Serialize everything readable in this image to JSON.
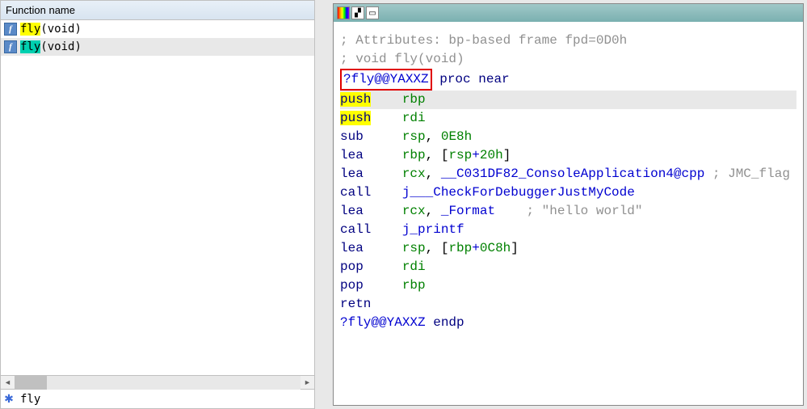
{
  "left": {
    "header": "Function name",
    "functions": [
      {
        "highlight_class": "hl-yellow",
        "name": "fly",
        "rest": "(void)"
      },
      {
        "highlight_class": "hl-teal",
        "name": "fly",
        "rest": "(void)"
      }
    ],
    "search_value": "fly"
  },
  "toolbar": {
    "icon1": "rainbow",
    "icon2": "graph",
    "icon3": "window"
  },
  "disasm": {
    "attr_comment": "; Attributes: bp-based frame fpd=0D0h",
    "decl_comment": "; void fly(void)",
    "mangled": "?fly@@YAXXZ",
    "proc_near": " proc near",
    "lines": [
      {
        "mn": "push",
        "mn_hl": true,
        "args": [
          {
            "t": "rbp",
            "c": "green"
          }
        ],
        "row_hl": true
      },
      {
        "mn": "push",
        "mn_hl": true,
        "args": [
          {
            "t": "rdi",
            "c": "green"
          }
        ]
      },
      {
        "mn": "sub",
        "args": [
          {
            "t": "rsp",
            "c": "green"
          },
          {
            "t": ", ",
            "c": "black"
          },
          {
            "t": "0E8h",
            "c": "green"
          }
        ]
      },
      {
        "mn": "lea",
        "args": [
          {
            "t": "rbp",
            "c": "green"
          },
          {
            "t": ", [",
            "c": "black"
          },
          {
            "t": "rsp",
            "c": "green"
          },
          {
            "t": "+",
            "c": "blue"
          },
          {
            "t": "20h",
            "c": "green"
          },
          {
            "t": "]",
            "c": "black"
          }
        ]
      },
      {
        "mn": "lea",
        "args": [
          {
            "t": "rcx",
            "c": "green"
          },
          {
            "t": ", ",
            "c": "black"
          },
          {
            "t": "__C031DF82_ConsoleApplication4@cpp",
            "c": "blue"
          },
          {
            "t": " ; JMC_flag",
            "c": "comment"
          }
        ]
      },
      {
        "mn": "call",
        "args": [
          {
            "t": "j___CheckForDebuggerJustMyCode",
            "c": "blue"
          }
        ]
      },
      {
        "mn": "lea",
        "args": [
          {
            "t": "rcx",
            "c": "green"
          },
          {
            "t": ", ",
            "c": "black"
          },
          {
            "t": "_Format",
            "c": "blue"
          },
          {
            "t": "    ; \"hello world\"",
            "c": "comment"
          }
        ]
      },
      {
        "mn": "call",
        "args": [
          {
            "t": "j_printf",
            "c": "blue"
          }
        ]
      },
      {
        "mn": "lea",
        "args": [
          {
            "t": "rsp",
            "c": "green"
          },
          {
            "t": ", [",
            "c": "black"
          },
          {
            "t": "rbp",
            "c": "green"
          },
          {
            "t": "+",
            "c": "blue"
          },
          {
            "t": "0C8h",
            "c": "green"
          },
          {
            "t": "]",
            "c": "black"
          }
        ]
      },
      {
        "mn": "pop",
        "args": [
          {
            "t": "rdi",
            "c": "green"
          }
        ]
      },
      {
        "mn": "pop",
        "args": [
          {
            "t": "rbp",
            "c": "green"
          }
        ]
      },
      {
        "mn": "retn",
        "args": []
      }
    ],
    "endp_label": "?fly@@YAXXZ",
    "endp_kw": " endp"
  }
}
